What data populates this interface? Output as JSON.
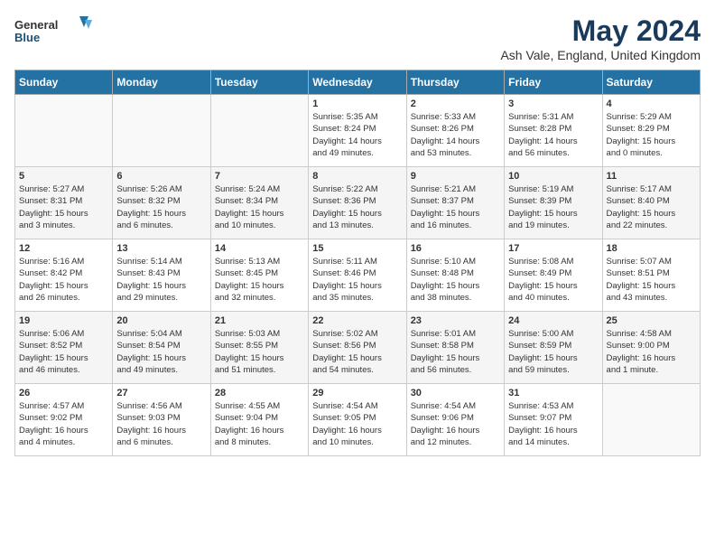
{
  "header": {
    "logo_general": "General",
    "logo_blue": "Blue",
    "title": "May 2024",
    "location": "Ash Vale, England, United Kingdom"
  },
  "days_of_week": [
    "Sunday",
    "Monday",
    "Tuesday",
    "Wednesday",
    "Thursday",
    "Friday",
    "Saturday"
  ],
  "weeks": [
    [
      {
        "day": "",
        "info": ""
      },
      {
        "day": "",
        "info": ""
      },
      {
        "day": "",
        "info": ""
      },
      {
        "day": "1",
        "info": "Sunrise: 5:35 AM\nSunset: 8:24 PM\nDaylight: 14 hours\nand 49 minutes."
      },
      {
        "day": "2",
        "info": "Sunrise: 5:33 AM\nSunset: 8:26 PM\nDaylight: 14 hours\nand 53 minutes."
      },
      {
        "day": "3",
        "info": "Sunrise: 5:31 AM\nSunset: 8:28 PM\nDaylight: 14 hours\nand 56 minutes."
      },
      {
        "day": "4",
        "info": "Sunrise: 5:29 AM\nSunset: 8:29 PM\nDaylight: 15 hours\nand 0 minutes."
      }
    ],
    [
      {
        "day": "5",
        "info": "Sunrise: 5:27 AM\nSunset: 8:31 PM\nDaylight: 15 hours\nand 3 minutes."
      },
      {
        "day": "6",
        "info": "Sunrise: 5:26 AM\nSunset: 8:32 PM\nDaylight: 15 hours\nand 6 minutes."
      },
      {
        "day": "7",
        "info": "Sunrise: 5:24 AM\nSunset: 8:34 PM\nDaylight: 15 hours\nand 10 minutes."
      },
      {
        "day": "8",
        "info": "Sunrise: 5:22 AM\nSunset: 8:36 PM\nDaylight: 15 hours\nand 13 minutes."
      },
      {
        "day": "9",
        "info": "Sunrise: 5:21 AM\nSunset: 8:37 PM\nDaylight: 15 hours\nand 16 minutes."
      },
      {
        "day": "10",
        "info": "Sunrise: 5:19 AM\nSunset: 8:39 PM\nDaylight: 15 hours\nand 19 minutes."
      },
      {
        "day": "11",
        "info": "Sunrise: 5:17 AM\nSunset: 8:40 PM\nDaylight: 15 hours\nand 22 minutes."
      }
    ],
    [
      {
        "day": "12",
        "info": "Sunrise: 5:16 AM\nSunset: 8:42 PM\nDaylight: 15 hours\nand 26 minutes."
      },
      {
        "day": "13",
        "info": "Sunrise: 5:14 AM\nSunset: 8:43 PM\nDaylight: 15 hours\nand 29 minutes."
      },
      {
        "day": "14",
        "info": "Sunrise: 5:13 AM\nSunset: 8:45 PM\nDaylight: 15 hours\nand 32 minutes."
      },
      {
        "day": "15",
        "info": "Sunrise: 5:11 AM\nSunset: 8:46 PM\nDaylight: 15 hours\nand 35 minutes."
      },
      {
        "day": "16",
        "info": "Sunrise: 5:10 AM\nSunset: 8:48 PM\nDaylight: 15 hours\nand 38 minutes."
      },
      {
        "day": "17",
        "info": "Sunrise: 5:08 AM\nSunset: 8:49 PM\nDaylight: 15 hours\nand 40 minutes."
      },
      {
        "day": "18",
        "info": "Sunrise: 5:07 AM\nSunset: 8:51 PM\nDaylight: 15 hours\nand 43 minutes."
      }
    ],
    [
      {
        "day": "19",
        "info": "Sunrise: 5:06 AM\nSunset: 8:52 PM\nDaylight: 15 hours\nand 46 minutes."
      },
      {
        "day": "20",
        "info": "Sunrise: 5:04 AM\nSunset: 8:54 PM\nDaylight: 15 hours\nand 49 minutes."
      },
      {
        "day": "21",
        "info": "Sunrise: 5:03 AM\nSunset: 8:55 PM\nDaylight: 15 hours\nand 51 minutes."
      },
      {
        "day": "22",
        "info": "Sunrise: 5:02 AM\nSunset: 8:56 PM\nDaylight: 15 hours\nand 54 minutes."
      },
      {
        "day": "23",
        "info": "Sunrise: 5:01 AM\nSunset: 8:58 PM\nDaylight: 15 hours\nand 56 minutes."
      },
      {
        "day": "24",
        "info": "Sunrise: 5:00 AM\nSunset: 8:59 PM\nDaylight: 15 hours\nand 59 minutes."
      },
      {
        "day": "25",
        "info": "Sunrise: 4:58 AM\nSunset: 9:00 PM\nDaylight: 16 hours\nand 1 minute."
      }
    ],
    [
      {
        "day": "26",
        "info": "Sunrise: 4:57 AM\nSunset: 9:02 PM\nDaylight: 16 hours\nand 4 minutes."
      },
      {
        "day": "27",
        "info": "Sunrise: 4:56 AM\nSunset: 9:03 PM\nDaylight: 16 hours\nand 6 minutes."
      },
      {
        "day": "28",
        "info": "Sunrise: 4:55 AM\nSunset: 9:04 PM\nDaylight: 16 hours\nand 8 minutes."
      },
      {
        "day": "29",
        "info": "Sunrise: 4:54 AM\nSunset: 9:05 PM\nDaylight: 16 hours\nand 10 minutes."
      },
      {
        "day": "30",
        "info": "Sunrise: 4:54 AM\nSunset: 9:06 PM\nDaylight: 16 hours\nand 12 minutes."
      },
      {
        "day": "31",
        "info": "Sunrise: 4:53 AM\nSunset: 9:07 PM\nDaylight: 16 hours\nand 14 minutes."
      },
      {
        "day": "",
        "info": ""
      }
    ]
  ]
}
